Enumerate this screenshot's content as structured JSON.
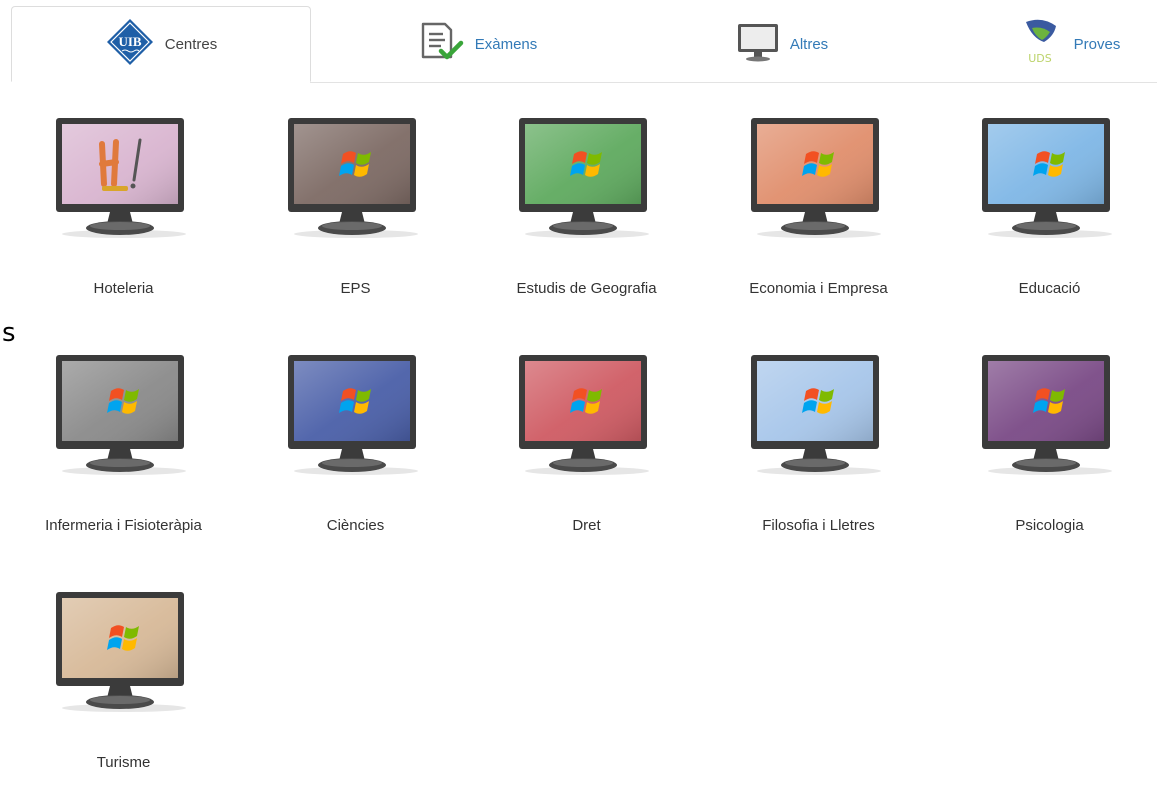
{
  "tabs": [
    {
      "label": "Centres",
      "icon": "uib-logo-icon",
      "active": true
    },
    {
      "label": "Exàmens",
      "icon": "checklist-icon",
      "active": false
    },
    {
      "label": "Altres",
      "icon": "monitor-icon",
      "active": false
    },
    {
      "label": "Proves",
      "icon": "uds-logo-icon",
      "active": false
    }
  ],
  "logos": {
    "uib": "UIB",
    "uds": "UDS"
  },
  "stray_text": "s",
  "services": [
    {
      "label": "Hoteleria",
      "screen_color": "#d9b5d0",
      "icon": "hotel-logo-icon"
    },
    {
      "label": "EPS",
      "screen_color": "#7d6a64",
      "icon": "windows-logo-icon"
    },
    {
      "label": "Estudis de Geografia",
      "screen_color": "#5faa5f",
      "icon": "windows-logo-icon"
    },
    {
      "label": "Economia i Empresa",
      "screen_color": "#e08e6c",
      "icon": "windows-logo-icon"
    },
    {
      "label": "Educació",
      "screen_color": "#7fb7e6",
      "icon": "windows-logo-icon"
    },
    {
      "label": "Infermeria i Fisioteràpia",
      "screen_color": "#8a8a8a",
      "icon": "windows-logo-icon"
    },
    {
      "label": "Ciències",
      "screen_color": "#4a5fa8",
      "icon": "windows-logo-icon"
    },
    {
      "label": "Dret",
      "screen_color": "#cf5b63",
      "icon": "windows-logo-icon"
    },
    {
      "label": "Filosofia i Lletres",
      "screen_color": "#a7c6ea",
      "icon": "windows-logo-icon"
    },
    {
      "label": "Psicologia",
      "screen_color": "#7a4a86",
      "icon": "windows-logo-icon"
    },
    {
      "label": "Turisme",
      "screen_color": "#d7b998",
      "icon": "windows-logo-icon"
    }
  ]
}
